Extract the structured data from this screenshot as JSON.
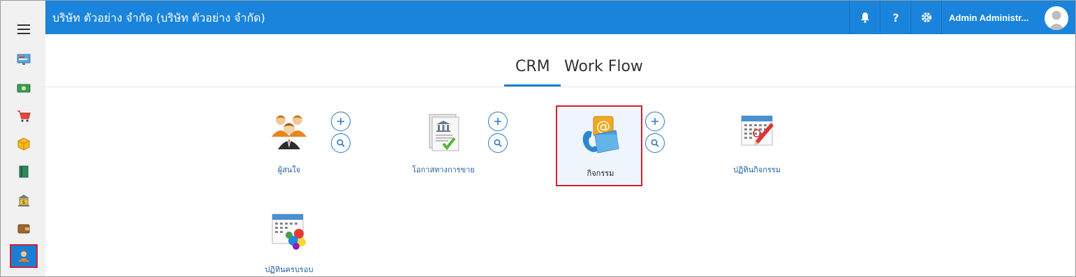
{
  "topbar": {
    "company": "บริษัท ตัวอย่าง จำกัด (บริษัท ตัวอย่าง จำกัด)",
    "user_name": "Admin Administr...",
    "buttons": [
      "bell-icon",
      "help-icon",
      "gear-icon"
    ],
    "color": "#1a84dc"
  },
  "sidebar": {
    "items": [
      {
        "icon": "dashboard-icon"
      },
      {
        "icon": "money-icon"
      },
      {
        "icon": "cart-icon"
      },
      {
        "icon": "box-icon"
      },
      {
        "icon": "book-icon"
      },
      {
        "icon": "bank-icon"
      },
      {
        "icon": "wallet-icon"
      },
      {
        "icon": "crm-people-icon",
        "active": true
      }
    ]
  },
  "tabs": [
    {
      "label": "CRM",
      "active": true
    },
    {
      "label": "Work Flow",
      "active": false
    }
  ],
  "modules": [
    {
      "label": "ผู้สนใจ",
      "icon": "leads-people-icon"
    },
    {
      "label": "โอกาสทางการขาย",
      "icon": "opportunity-document-icon"
    },
    {
      "label": "กิจกรรม",
      "icon": "activity-mail-icon",
      "selected": true
    },
    {
      "label": "ปฏิทินกิจกรรม",
      "icon": "activity-calendar-icon"
    },
    {
      "label": "ปฏิทินครบรอบ",
      "icon": "anniversary-calendar-icon"
    }
  ],
  "accent": "#1a7fd4",
  "highlight": "#d01f2e"
}
